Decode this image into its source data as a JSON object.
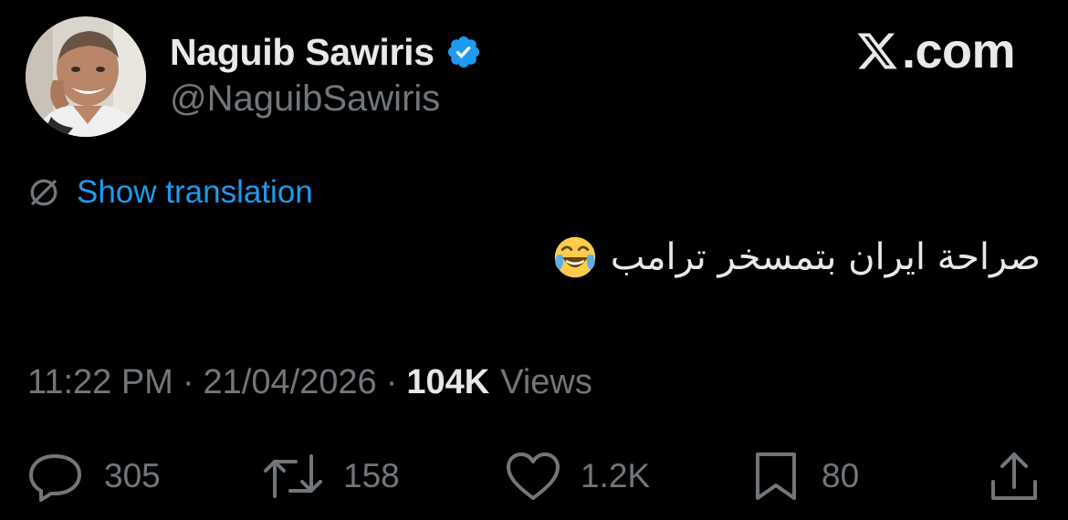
{
  "header": {
    "display_name": "Naguib Sawiris",
    "handle": "@NaguibSawiris",
    "verified_icon": "verified-badge-icon",
    "brand_domain": ".com",
    "brand_icon": "x-logo-icon"
  },
  "translation": {
    "icon": "globe-icon",
    "label": "Show translation"
  },
  "tweet": {
    "text": "صراحة ايران بتمسخر ترامب",
    "emoji_icon": "face-with-tears-of-joy-icon"
  },
  "meta": {
    "time": "11:22 PM",
    "separator": "·",
    "date": "21/04/2026",
    "views_count": "104K",
    "views_label": "Views"
  },
  "actions": {
    "replies": "305",
    "reposts": "158",
    "likes": "1.2K",
    "bookmarks": "80"
  },
  "colors": {
    "background": "#000000",
    "primary_text": "#e7e9ea",
    "secondary_text": "#71767b",
    "link": "#1d9bf0",
    "verified": "#1d9bf0"
  }
}
